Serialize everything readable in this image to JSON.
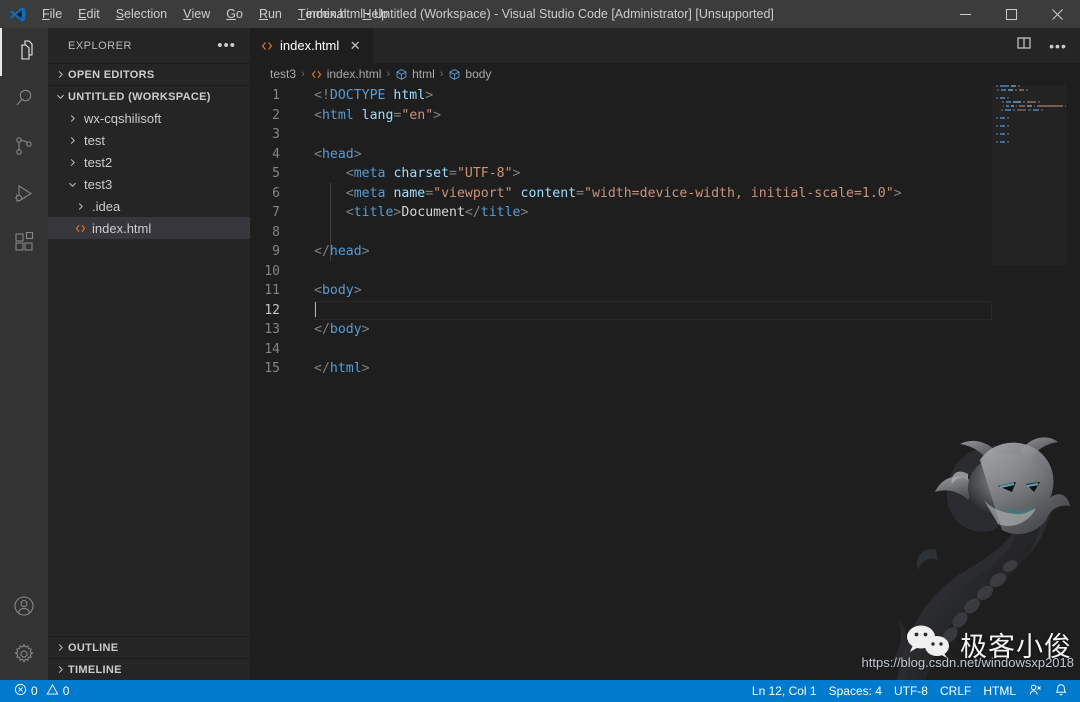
{
  "window": {
    "title": "index.html - Untitled (Workspace) - Visual Studio Code [Administrator] [Unsupported]",
    "logo": "vscode-logo",
    "controls": {
      "minimize": "minimize-icon",
      "maximize": "maximize-icon",
      "close": "close-icon"
    }
  },
  "menu": [
    {
      "label": "File",
      "acc": "F",
      "rest": "ile"
    },
    {
      "label": "Edit",
      "acc": "E",
      "rest": "dit"
    },
    {
      "label": "Selection",
      "acc": "S",
      "rest": "election"
    },
    {
      "label": "View",
      "acc": "V",
      "rest": "iew"
    },
    {
      "label": "Go",
      "acc": "G",
      "rest": "o"
    },
    {
      "label": "Run",
      "acc": "R",
      "rest": "un"
    },
    {
      "label": "Terminal",
      "acc": "T",
      "rest": "erminal"
    },
    {
      "label": "Help",
      "acc": "H",
      "rest": "elp"
    }
  ],
  "activitybar": {
    "top": [
      {
        "name": "explorer",
        "icon": "files-icon",
        "active": true
      },
      {
        "name": "search",
        "icon": "search-icon",
        "active": false
      },
      {
        "name": "source-control",
        "icon": "source-control-icon",
        "active": false
      },
      {
        "name": "run-debug",
        "icon": "run-debug-icon",
        "active": false
      },
      {
        "name": "extensions",
        "icon": "extensions-icon",
        "active": false
      }
    ],
    "bottom": [
      {
        "name": "accounts",
        "icon": "account-icon"
      },
      {
        "name": "manage",
        "icon": "gear-icon"
      }
    ]
  },
  "sidebar": {
    "title": "EXPLORER",
    "more": "…",
    "sections": [
      {
        "label": "OPEN EDITORS",
        "expanded": false
      },
      {
        "label": "UNTITLED (WORKSPACE)",
        "expanded": true
      }
    ],
    "tree": [
      {
        "label": "wx-cqshilisoft",
        "depth": 1,
        "type": "folder",
        "expanded": false,
        "selected": false
      },
      {
        "label": "test",
        "depth": 1,
        "type": "folder",
        "expanded": false,
        "selected": false
      },
      {
        "label": "test2",
        "depth": 1,
        "type": "folder",
        "expanded": false,
        "selected": false
      },
      {
        "label": "test3",
        "depth": 1,
        "type": "folder",
        "expanded": true,
        "selected": false
      },
      {
        "label": ".idea",
        "depth": 2,
        "type": "folder",
        "expanded": false,
        "selected": false
      },
      {
        "label": "index.html",
        "depth": 2,
        "type": "html-file",
        "expanded": false,
        "selected": true
      }
    ],
    "bottom_sections": [
      {
        "label": "OUTLINE",
        "expanded": false
      },
      {
        "label": "TIMELINE",
        "expanded": false
      }
    ]
  },
  "editor": {
    "tab": {
      "label": "index.html",
      "icon": "html-file-icon",
      "close": "✕"
    },
    "actions": [
      {
        "name": "split-editor",
        "icon": "split-editor-icon"
      },
      {
        "name": "more-actions",
        "icon": "ellipsis-icon"
      }
    ],
    "breadcrumbs": [
      {
        "label": "test3",
        "icon": "none"
      },
      {
        "label": "index.html",
        "icon": "html-file-icon"
      },
      {
        "label": "html",
        "icon": "symbol-field-icon"
      },
      {
        "label": "body",
        "icon": "symbol-field-icon"
      }
    ],
    "separator": "›",
    "lines": [
      {
        "n": 1,
        "tokens": [
          {
            "t": "brk",
            "v": "<!"
          },
          {
            "t": "doc",
            "v": "DOCTYPE "
          },
          {
            "t": "docn",
            "v": "html"
          },
          {
            "t": "brk",
            "v": ">"
          }
        ]
      },
      {
        "n": 2,
        "tokens": [
          {
            "t": "brk",
            "v": "<"
          },
          {
            "t": "tag",
            "v": "html"
          },
          {
            "t": "txt",
            "v": " "
          },
          {
            "t": "attr",
            "v": "lang"
          },
          {
            "t": "brk",
            "v": "="
          },
          {
            "t": "str",
            "v": "\"en\""
          },
          {
            "t": "brk",
            "v": ">"
          }
        ]
      },
      {
        "n": 3,
        "tokens": []
      },
      {
        "n": 4,
        "tokens": [
          {
            "t": "brk",
            "v": "<"
          },
          {
            "t": "tag",
            "v": "head"
          },
          {
            "t": "brk",
            "v": ">"
          }
        ]
      },
      {
        "n": 5,
        "tokens": [
          {
            "t": "txt",
            "v": "    "
          },
          {
            "t": "brk",
            "v": "<"
          },
          {
            "t": "tag",
            "v": "meta"
          },
          {
            "t": "txt",
            "v": " "
          },
          {
            "t": "attr",
            "v": "charset"
          },
          {
            "t": "brk",
            "v": "="
          },
          {
            "t": "str",
            "v": "\"UTF-8\""
          },
          {
            "t": "brk",
            "v": ">"
          }
        ]
      },
      {
        "n": 6,
        "tokens": [
          {
            "t": "txt",
            "v": "    "
          },
          {
            "t": "brk",
            "v": "<"
          },
          {
            "t": "tag",
            "v": "meta"
          },
          {
            "t": "txt",
            "v": " "
          },
          {
            "t": "attr",
            "v": "name"
          },
          {
            "t": "brk",
            "v": "="
          },
          {
            "t": "str",
            "v": "\"viewport\""
          },
          {
            "t": "txt",
            "v": " "
          },
          {
            "t": "attr",
            "v": "content"
          },
          {
            "t": "brk",
            "v": "="
          },
          {
            "t": "str",
            "v": "\"width=device-width, initial-scale=1.0\""
          },
          {
            "t": "brk",
            "v": ">"
          }
        ]
      },
      {
        "n": 7,
        "tokens": [
          {
            "t": "txt",
            "v": "    "
          },
          {
            "t": "brk",
            "v": "<"
          },
          {
            "t": "tag",
            "v": "title"
          },
          {
            "t": "brk",
            "v": ">"
          },
          {
            "t": "txt",
            "v": "Document"
          },
          {
            "t": "brk",
            "v": "</"
          },
          {
            "t": "tag",
            "v": "title"
          },
          {
            "t": "brk",
            "v": ">"
          }
        ]
      },
      {
        "n": 8,
        "tokens": []
      },
      {
        "n": 9,
        "tokens": [
          {
            "t": "brk",
            "v": "</"
          },
          {
            "t": "tag",
            "v": "head"
          },
          {
            "t": "brk",
            "v": ">"
          }
        ]
      },
      {
        "n": 10,
        "tokens": []
      },
      {
        "n": 11,
        "tokens": [
          {
            "t": "brk",
            "v": "<"
          },
          {
            "t": "tag",
            "v": "body"
          },
          {
            "t": "brk",
            "v": ">"
          }
        ]
      },
      {
        "n": 12,
        "tokens": [],
        "current": true,
        "cursor": true
      },
      {
        "n": 13,
        "tokens": [
          {
            "t": "brk",
            "v": "</"
          },
          {
            "t": "tag",
            "v": "body"
          },
          {
            "t": "brk",
            "v": ">"
          }
        ]
      },
      {
        "n": 14,
        "tokens": []
      },
      {
        "n": 15,
        "tokens": [
          {
            "t": "brk",
            "v": "</"
          },
          {
            "t": "tag",
            "v": "html"
          },
          {
            "t": "brk",
            "v": ">"
          }
        ]
      }
    ]
  },
  "watermark": {
    "brand_text": "极客小俊",
    "brand_icon": "wechat-icon",
    "url": "https://blog.csdn.net/windowsxp2018",
    "image": "dragon-illustration"
  },
  "statusbar": {
    "left": [
      {
        "name": "problems",
        "icon": "error-icon",
        "value": "0",
        "icon2": "warning-icon",
        "value2": "0"
      }
    ],
    "right": [
      {
        "name": "cursor-position",
        "label": "Ln 12, Col 1"
      },
      {
        "name": "indentation",
        "label": "Spaces: 4"
      },
      {
        "name": "encoding",
        "label": "UTF-8"
      },
      {
        "name": "eol",
        "label": "CRLF"
      },
      {
        "name": "language-mode",
        "label": "HTML"
      },
      {
        "name": "live-share",
        "label": "",
        "icon": "live-share-icon"
      },
      {
        "name": "notifications",
        "label": "",
        "icon": "bell-icon"
      }
    ]
  },
  "colors": {
    "accent": "#007acc",
    "titlebar_bg": "#3c3c3c",
    "sidebar_bg": "#252526",
    "editor_bg": "#1e1e1e",
    "activitybar_bg": "#333333",
    "tag": "#569cd6",
    "attribute": "#9cdcfe",
    "string": "#ce9178",
    "text": "#d4d4d4"
  }
}
